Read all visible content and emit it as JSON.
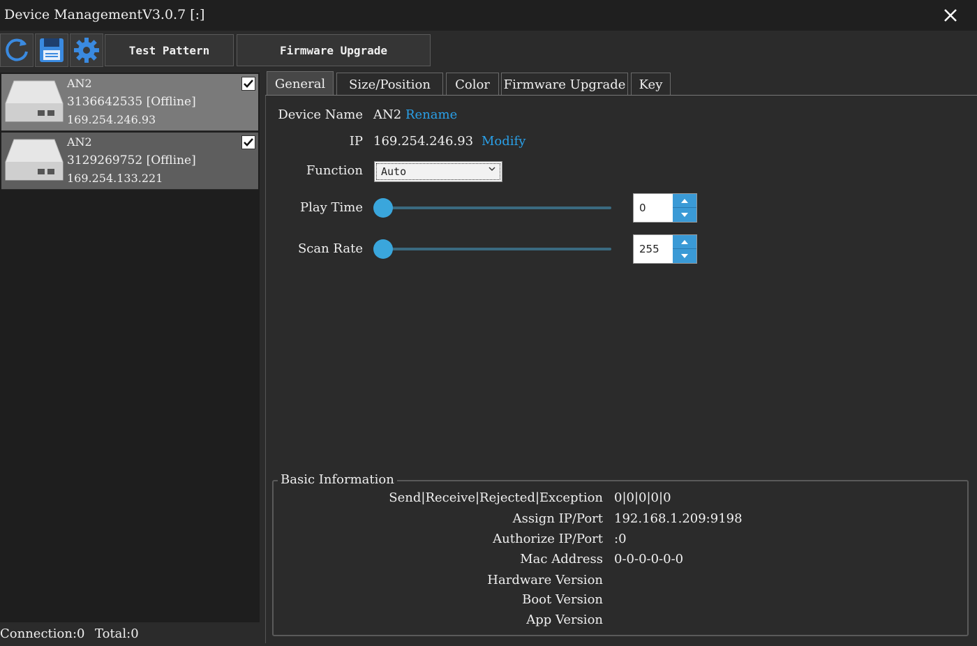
{
  "window": {
    "title": "Device ManagementV3.0.7 [:]"
  },
  "toolbar": {
    "icons": [
      "refresh-icon",
      "save-icon",
      "gear-icon"
    ],
    "test_pattern": "Test Pattern",
    "firmware_upgrade": "Firmware Upgrade"
  },
  "devices": [
    {
      "name": "AN2",
      "id": "3136642535",
      "status": "[Offline]",
      "ip": "169.254.246.93",
      "checked": true
    },
    {
      "name": "AN2",
      "id": "3129269752",
      "status": "[Offline]",
      "ip": "169.254.133.221",
      "checked": true
    }
  ],
  "status": {
    "connection": "Connection:0",
    "total": "Total:0"
  },
  "tabs": [
    "General",
    "Size/Position",
    "Color",
    "Firmware Upgrade",
    "Key"
  ],
  "active_tab": "General",
  "general": {
    "device_name_label": "Device Name",
    "device_name": "AN2",
    "rename": "Rename",
    "ip_label": "IP",
    "ip": "169.254.246.93",
    "modify": "Modify",
    "function_label": "Function",
    "function_value": "Auto",
    "play_time_label": "Play Time",
    "play_time": "0",
    "scan_rate_label": "Scan Rate",
    "scan_rate": "255"
  },
  "basic_info": {
    "title": "Basic Information",
    "rows": [
      {
        "label": "Send|Receive|Rejected|Exception",
        "value": "0|0|0|0|0"
      },
      {
        "label": "Assign IP/Port",
        "value": "192.168.1.209:9198"
      },
      {
        "label": "Authorize IP/Port",
        "value": ":0"
      },
      {
        "label": "Mac Address",
        "value": "0-0-0-0-0-0"
      },
      {
        "label": "Hardware Version",
        "value": ""
      },
      {
        "label": "Boot Version",
        "value": ""
      },
      {
        "label": "App Version",
        "value": ""
      }
    ]
  },
  "colors": {
    "accent": "#3aa6dc",
    "link": "#2aa0e8",
    "background": "#2b2b2b"
  }
}
